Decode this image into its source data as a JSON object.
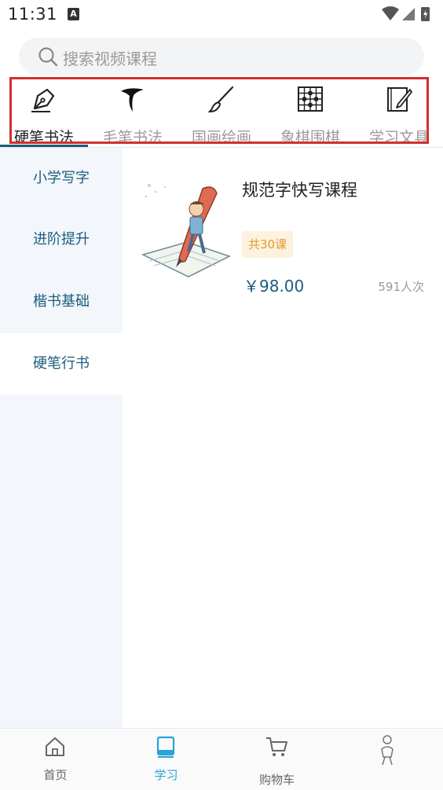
{
  "status_bar": {
    "time": "11:31",
    "notification_letter": "A"
  },
  "search": {
    "placeholder": "搜索视频课程",
    "icon": "search-icon"
  },
  "categories": [
    {
      "label": "硬笔书法",
      "icon": "fountain-pen-nib-icon",
      "active": true
    },
    {
      "label": "毛笔书法",
      "icon": "calligraphy-stroke-icon",
      "active": false
    },
    {
      "label": "国画绘画",
      "icon": "paint-brush-icon",
      "active": false
    },
    {
      "label": "象棋围棋",
      "icon": "chess-board-icon",
      "active": false
    },
    {
      "label": "学习文具",
      "icon": "notebook-pen-icon",
      "active": false
    }
  ],
  "side_menu": [
    {
      "label": "小学写字",
      "active": false
    },
    {
      "label": "进阶提升",
      "active": false
    },
    {
      "label": "楷书基础",
      "active": false
    },
    {
      "label": "硬笔行书",
      "active": true
    }
  ],
  "course": {
    "title": "规范字快写课程",
    "lessons": "共30课",
    "price": "￥98.00",
    "enrolled": "591人次"
  },
  "bottom_nav": [
    {
      "label": "首页",
      "icon": "home-icon",
      "active": false
    },
    {
      "label": "学习",
      "icon": "book-icon",
      "active": true
    },
    {
      "label": "购物车",
      "icon": "cart-icon",
      "active": false
    },
    {
      "label": "",
      "icon": "profile-sketch-icon",
      "active": false
    }
  ],
  "colors": {
    "accent": "#1a5d7e",
    "active_nav": "#2aa3d8",
    "highlight_box": "#d32f2f",
    "badge_text": "#e59a2b"
  }
}
